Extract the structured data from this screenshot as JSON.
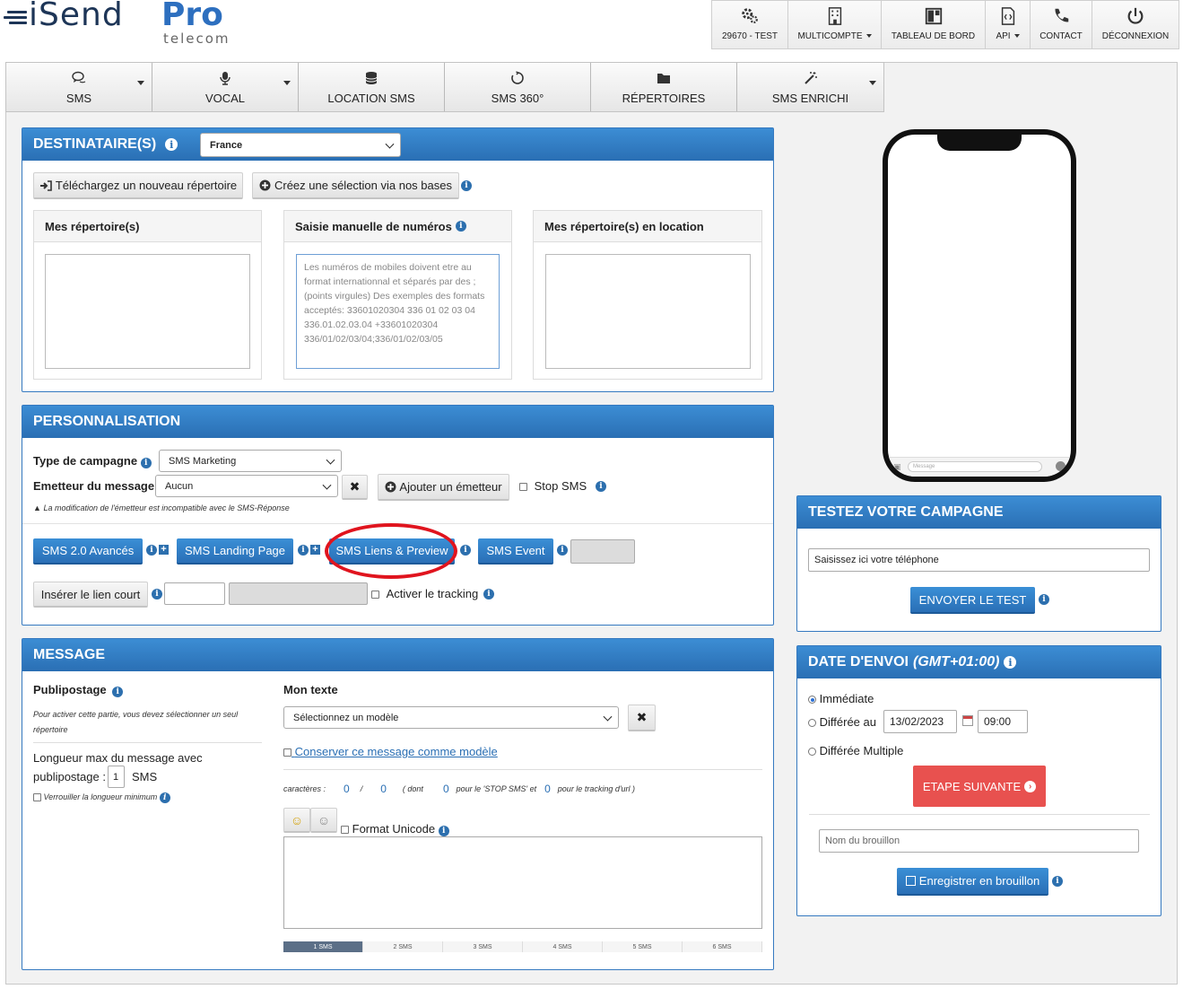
{
  "brand": {
    "name": "iSend",
    "pro": "Pro",
    "sub": "telecom"
  },
  "topbar": [
    {
      "label": "29670 - TEST",
      "icon": "gears-icon",
      "caret": false,
      "width": 85
    },
    {
      "label": "MULTICOMPTE",
      "icon": "building-icon",
      "caret": true,
      "width": 104
    },
    {
      "label": "TABLEAU DE BORD",
      "icon": "dashboard-icon",
      "caret": false,
      "width": 116
    },
    {
      "label": "API",
      "icon": "code-file-icon",
      "caret": true,
      "width": 50
    },
    {
      "label": "CONTACT",
      "icon": "phone-icon",
      "caret": false,
      "width": 69
    },
    {
      "label": "DÉCONNEXION",
      "icon": "power-icon",
      "caret": false,
      "width": 96
    }
  ],
  "nav": [
    {
      "label": "SMS",
      "icon": "chat-icon",
      "caret": true
    },
    {
      "label": "VOCAL",
      "icon": "microphone-icon",
      "caret": true
    },
    {
      "label": "LOCATION SMS",
      "icon": "database-icon",
      "caret": false
    },
    {
      "label": "SMS 360°",
      "icon": "circle-refresh-icon",
      "caret": false
    },
    {
      "label": "RÉPERTOIRES",
      "icon": "folder-icon",
      "caret": false
    },
    {
      "label": "SMS ENRICHI",
      "icon": "magic-wand-icon",
      "caret": true
    }
  ],
  "destinataires": {
    "title": "DESTINATAIRE(S)",
    "country": "France",
    "upload_btn": "Téléchargez un nouveau répertoire",
    "create_btn": "Créez une sélection via nos bases",
    "my_dirs": "Mes répertoire(s)",
    "manual": "Saisie manuelle de numéros",
    "manual_placeholder": "Les numéros de mobiles doivent etre au format internationnal et séparés par des ; (points virgules) Des exemples des formats acceptés: 33601020304   336 01 02 03 04   336.01.02.03.04   +33601020304   336/01/02/03/04;336/01/02/03/05",
    "rented_dirs": "Mes répertoire(s) en location"
  },
  "perso": {
    "title": "PERSONNALISATION",
    "type_label": "Type de campagne",
    "type_value": "SMS Marketing",
    "sender_label": "Emetteur du message",
    "sender_value": "Aucun",
    "add_sender": "Ajouter un émetteur",
    "stop_sms": "Stop SMS",
    "warning": "La modification de l'émetteur est incompatible avec le SMS-Réponse",
    "btn_sms20": "SMS 2.0 Avancés",
    "btn_landing": "SMS Landing Page",
    "btn_liens": "SMS Liens & Preview",
    "btn_event": "SMS Event",
    "short_link": "Insérer le lien court",
    "tracking": "Activer le tracking"
  },
  "message": {
    "title": "MESSAGE",
    "publipostage": "Publipostage",
    "publi_note": "Pour activer cette partie, vous devez sélectionner un seul répertoire",
    "maxlen_1": "Longueur max du message avec",
    "maxlen_2": "publipostage :",
    "maxlen_value": "1",
    "maxlen_unit": "SMS",
    "lock_min": "Verrouiller la longueur minimum",
    "mon_texte": "Mon texte",
    "model_select": "Sélectionnez un modèle",
    "keep_model": "Conserver ce message comme modèle",
    "chars_label": "caractères :",
    "chars_count": "0",
    "chars_sep": "/",
    "chars_total": "0",
    "dont": "( dont",
    "stop_count": "0",
    "stop_text": "pour le 'STOP SMS' et",
    "track_count": "0",
    "track_text": "pour le tracking d'url )",
    "unicode": "Format Unicode",
    "segments": [
      "1 SMS",
      "2 SMS",
      "3 SMS",
      "4 SMS",
      "5 SMS",
      "6 SMS"
    ]
  },
  "phone": {
    "message_placeholder": "Message"
  },
  "test": {
    "title": "TESTEZ VOTRE CAMPAGNE",
    "phone_placeholder": "Saisissez ici votre téléphone",
    "send_btn": "ENVOYER LE TEST"
  },
  "date": {
    "title": "DATE D'ENVOI",
    "tz": "(GMT+01:00)",
    "immediate": "Immédiate",
    "deferred": "Différée au",
    "date_value": "13/02/2023",
    "time_value": "09:00",
    "multiple": "Différée Multiple",
    "next_btn": "ETAPE SUIVANTE",
    "draft_placeholder": "Nom du brouillon",
    "save_btn": "Enregistrer en brouillon"
  },
  "colors": {
    "primary": "#2a6fb4",
    "danger": "#e8514f",
    "highlight": "#e0141e"
  }
}
